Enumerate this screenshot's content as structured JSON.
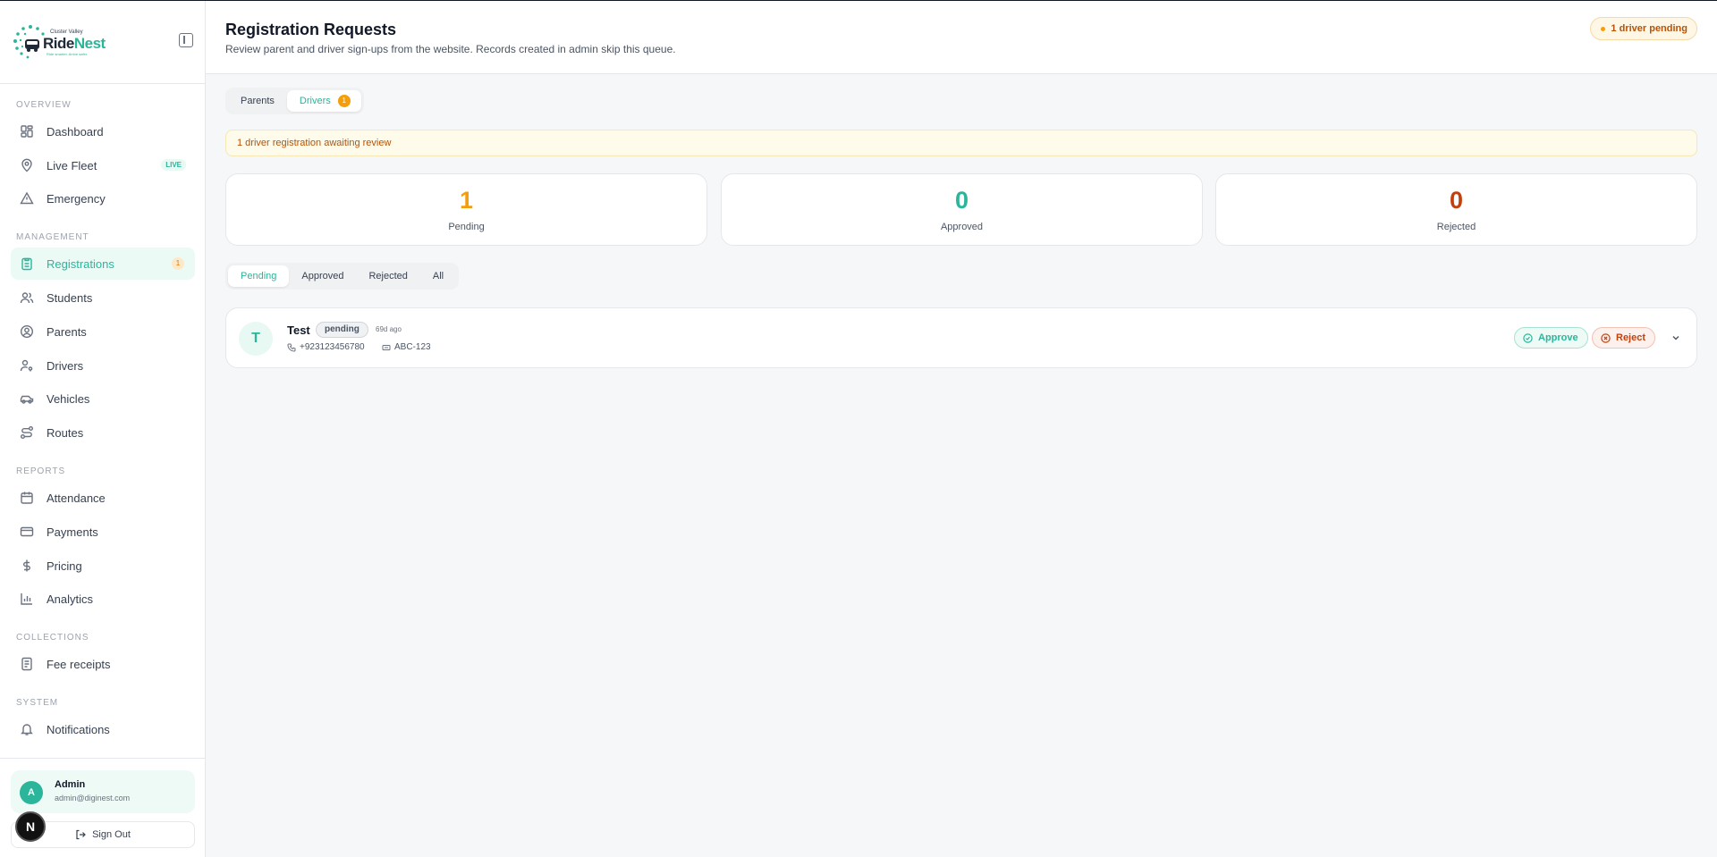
{
  "brand": {
    "tagline": "Cluster Valley",
    "name_part1": "Ride",
    "name_part2": "Nest",
    "sub": "Ride smarter. Arrive safer."
  },
  "sidebar": {
    "sections": [
      {
        "title": "OVERVIEW"
      },
      {
        "title": "MANAGEMENT"
      },
      {
        "title": "REPORTS"
      },
      {
        "title": "COLLECTIONS"
      },
      {
        "title": "SYSTEM"
      }
    ],
    "items": {
      "dashboard": "Dashboard",
      "live_fleet": "Live Fleet",
      "live_badge": "LIVE",
      "emergency": "Emergency",
      "registrations": "Registrations",
      "registrations_count": "1",
      "students": "Students",
      "parents": "Parents",
      "drivers": "Drivers",
      "vehicles": "Vehicles",
      "routes": "Routes",
      "attendance": "Attendance",
      "payments": "Payments",
      "pricing": "Pricing",
      "analytics": "Analytics",
      "fee_receipts": "Fee receipts",
      "notifications": "Notifications"
    }
  },
  "user": {
    "initial": "A",
    "name": "Admin",
    "email": "admin@diginest.com",
    "sign_out": "Sign Out"
  },
  "dev_badge": "N",
  "header": {
    "title": "Registration Requests",
    "subtitle": "Review parent and driver sign-ups from the website. Records created in admin skip this queue.",
    "pending_pill": "1 driver pending"
  },
  "type_tabs": {
    "parents": "Parents",
    "drivers": "Drivers",
    "drivers_count": "1"
  },
  "alert": "1 driver registration awaiting review",
  "stats": [
    {
      "value": "1",
      "label": "Pending",
      "color": "#f59e0b"
    },
    {
      "value": "0",
      "label": "Approved",
      "color": "#2bb59a"
    },
    {
      "value": "0",
      "label": "Rejected",
      "color": "#c2410c"
    }
  ],
  "status_tabs": [
    "Pending",
    "Approved",
    "Rejected",
    "All"
  ],
  "requests": [
    {
      "initial": "T",
      "name": "Test",
      "status": "pending",
      "time": "69d ago",
      "phone": "+923123456780",
      "plate": "ABC-123",
      "approve": "Approve",
      "reject": "Reject"
    }
  ],
  "colors": {
    "accent": "#2bb59a",
    "warning": "#f59e0b",
    "danger": "#c2410c"
  }
}
